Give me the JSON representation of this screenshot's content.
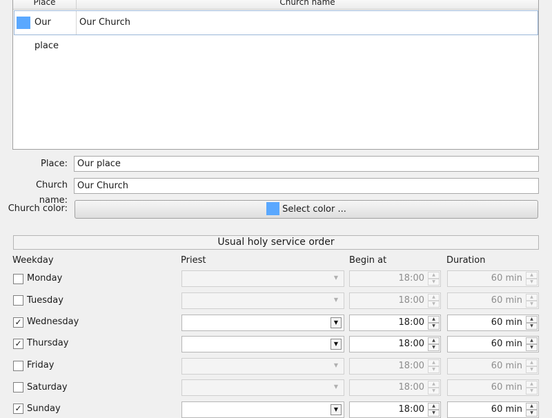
{
  "churches_table": {
    "headers": {
      "place": "Place",
      "church_name": "Church name"
    },
    "rows": [
      {
        "place": "Our place",
        "church_name": "Our Church",
        "color": "#5aa8ff"
      }
    ]
  },
  "form": {
    "place_label": "Place:",
    "place_value": "Our place",
    "church_name_label": "Church name:",
    "church_name_value": "Our Church",
    "church_color_label": "Church color:",
    "select_color_label": "Select color ...",
    "church_color": "#5aa8ff"
  },
  "service_order": {
    "title": "Usual holy service order",
    "columns": {
      "weekday": "Weekday",
      "priest": "Priest",
      "begin_at": "Begin at",
      "duration": "Duration"
    },
    "days": [
      {
        "name": "Monday",
        "checked": false,
        "priest": "",
        "begin": "18:00",
        "duration": "60 min"
      },
      {
        "name": "Tuesday",
        "checked": false,
        "priest": "",
        "begin": "18:00",
        "duration": "60 min"
      },
      {
        "name": "Wednesday",
        "checked": true,
        "priest": "",
        "begin": "18:00",
        "duration": "60 min"
      },
      {
        "name": "Thursday",
        "checked": true,
        "priest": "",
        "begin": "18:00",
        "duration": "60 min"
      },
      {
        "name": "Friday",
        "checked": false,
        "priest": "",
        "begin": "18:00",
        "duration": "60 min"
      },
      {
        "name": "Saturday",
        "checked": false,
        "priest": "",
        "begin": "18:00",
        "duration": "60 min"
      },
      {
        "name": "Sunday",
        "checked": true,
        "priest": "",
        "begin": "18:00",
        "duration": "60 min"
      }
    ]
  },
  "icons": {
    "checkmark": "check-icon",
    "dropdown": "chevron-down-icon",
    "spin_up": "arrow-up-icon",
    "spin_down": "arrow-down-icon"
  }
}
